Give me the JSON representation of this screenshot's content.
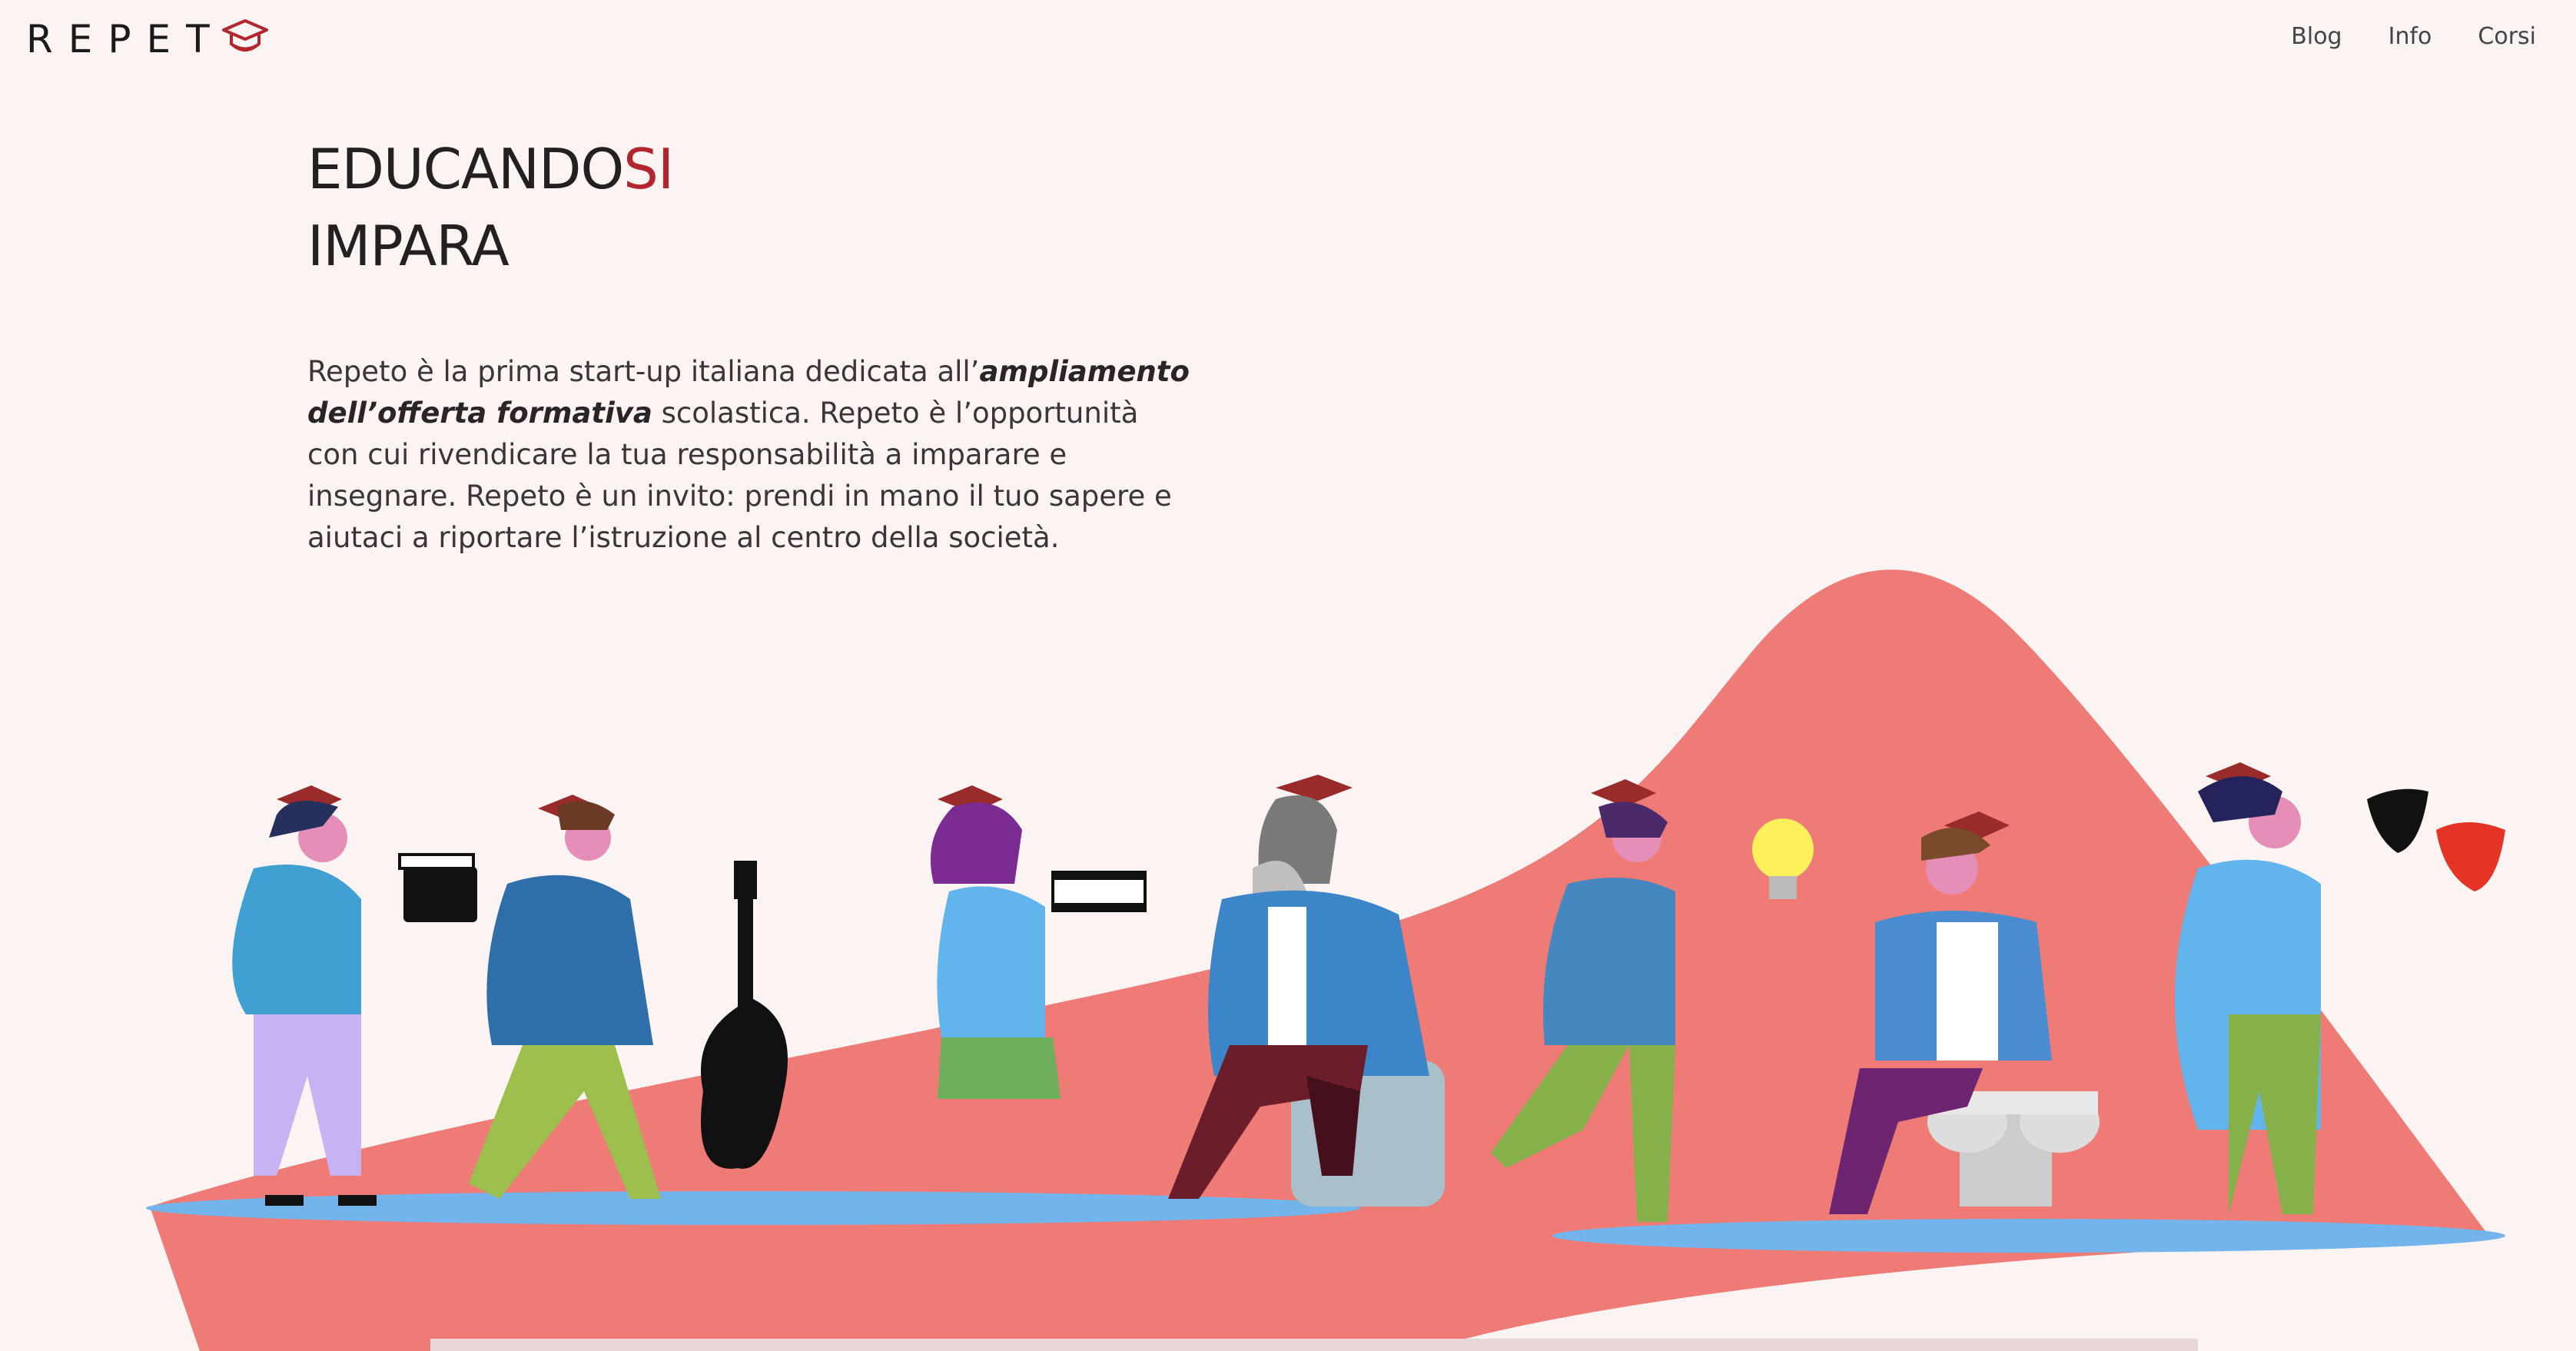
{
  "brand": {
    "name": "REPET"
  },
  "nav": {
    "items": [
      "Blog",
      "Info",
      "Corsi"
    ]
  },
  "hero": {
    "title_part1": "EDUCANDO",
    "title_accent": "SI",
    "title_line2": "IMPARA",
    "paragraph_before": "Repeto è la prima start-up italiana dedicata all’",
    "paragraph_bold": "ampliamento dell’offerta formativa",
    "paragraph_after": " scolastica. Repeto è l’opportunità con cui rivendicare la tua responsabilità a imparare e insegnare. Repeto è un invito: prendi in mano il tuo sapere e aiutaci a riportare l’istruzione al centro della società."
  },
  "colors": {
    "accent": "#b3262f",
    "background": "#fcf3f3",
    "hill": "#ef7b76",
    "platform": "#74b4ec"
  }
}
